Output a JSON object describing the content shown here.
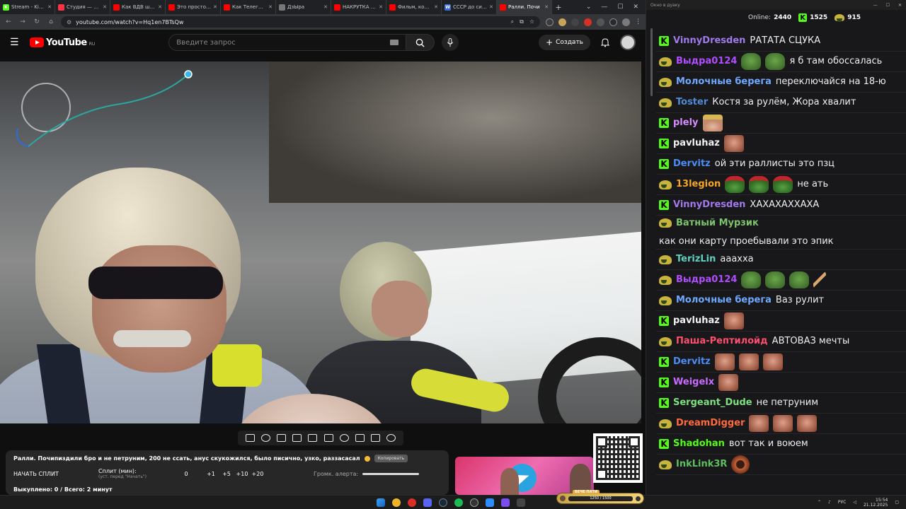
{
  "browser": {
    "tabs": [
      {
        "title": "Stream - Kick D",
        "fav": "K",
        "color": "#53fc18",
        "active": false
      },
      {
        "title": "Студия — VK В",
        "fav": "",
        "color": "#ff3347",
        "active": false
      },
      {
        "title": "Как ВДВ штурм",
        "fav": "",
        "color": "#ff0000",
        "active": false
      },
      {
        "title": "Это просто пра",
        "fav": "",
        "color": "#ff0000",
        "active": false
      },
      {
        "title": "Как Телеграм м",
        "fav": "",
        "color": "#ff0000",
        "active": false
      },
      {
        "title": "ДзЫра",
        "fav": "",
        "color": "#777777",
        "active": false
      },
      {
        "title": "НАКРУТКА УБИ",
        "fav": "",
        "color": "#ff0000",
        "active": false
      },
      {
        "title": "Фильм, которы",
        "fav": "",
        "color": "#ff0000",
        "active": false
      },
      {
        "title": "СССР до сих п",
        "fav": "W",
        "color": "#3a6bd8",
        "active": false
      },
      {
        "title": "Ралли. Почи",
        "fav": "",
        "color": "#ff0000",
        "active": true
      }
    ],
    "url": "youtube.com/watch?v=Hq1en7BTsQw"
  },
  "youtube": {
    "logo_text": "YouTube",
    "region": "RU",
    "search_placeholder": "Введите запрос",
    "create_label": "Создать"
  },
  "description": {
    "title": "Ралли. Почипиздили бро и не петруним, 200 не ссать, анус скукожился, было писично, узко, раззасасал",
    "copy_label": "Копировать",
    "split_button": "НАЧАТЬ СПЛИТ",
    "split_label": "Сплит (мин):",
    "split_sub": "(уст. перед \"Начать\")",
    "split_value": "0",
    "increments": [
      "+1",
      "+5",
      "+10",
      "+20"
    ],
    "volume_label": "Громк. алерта:",
    "volume_level": 1.0,
    "spent_text": "Выкуплено: 0 / Всего: 2 минут"
  },
  "party_widget": {
    "label": "ВЕЧЕ ПАТИ",
    "progress_text": "1250 / 1500"
  },
  "chat": {
    "window_title": "Окно в дуаку",
    "online_label": "Online:",
    "online_count": "2440",
    "kick_count": "1525",
    "coin_count": "915",
    "messages": [
      {
        "badge": "k",
        "nick": "VinnyDresden",
        "color": "#9f7aea",
        "text": "РАТАТА СЦУКА",
        "emotes": []
      },
      {
        "badge": "frog",
        "nick": "Выдра0124",
        "color": "#b04dff",
        "text": "я б там обоссалась",
        "emotes": [
          "frog",
          "frog"
        ]
      },
      {
        "badge": "frog",
        "nick": "Молочные берега",
        "color": "#6fa8ff",
        "text": "переключайся на 18-ю",
        "emotes": []
      },
      {
        "badge": "frog",
        "nick": "Toster",
        "color": "#4f8bd6",
        "text": "Костя за рулём, Жора хвалит",
        "emotes": []
      },
      {
        "badge": "k",
        "nick": "plely",
        "color": "#d78bff",
        "text": "",
        "emotes": [
          "blonde"
        ]
      },
      {
        "badge": "k",
        "nick": "pavluhaz",
        "color": "#f2f2f2",
        "text": "",
        "emotes": [
          "face"
        ]
      },
      {
        "badge": "k",
        "nick": "Dervitz",
        "color": "#4c8cf5",
        "text": "ой эти раллисты это пзц",
        "emotes": []
      },
      {
        "badge": "frog",
        "nick": "13legion",
        "color": "#f5a623",
        "text": "не ать",
        "emotes": [
          "xmas",
          "xmas",
          "xmas"
        ]
      },
      {
        "badge": "k",
        "nick": "VinnyDresden",
        "color": "#9f7aea",
        "text": "ХАХАХАХХАХА",
        "emotes": []
      },
      {
        "badge": "frog",
        "nick": "Ватный Мурзик",
        "color": "#7cc26c",
        "text": "как они карту проебывали это эпик",
        "emotes": []
      },
      {
        "badge": "frog",
        "nick": "TerizLin",
        "color": "#5fd0c0",
        "text": "аааххa",
        "emotes": []
      },
      {
        "badge": "frog",
        "nick": "Выдра0124",
        "color": "#b04dff",
        "text": "",
        "emotes": [
          "frog",
          "frog",
          "frog",
          "cig"
        ]
      },
      {
        "badge": "frog",
        "nick": "Молочные берега",
        "color": "#6fa8ff",
        "text": "Ваз рулит",
        "emotes": []
      },
      {
        "badge": "k",
        "nick": "pavluhaz",
        "color": "#f2f2f2",
        "text": "",
        "emotes": [
          "face"
        ]
      },
      {
        "badge": "frog",
        "nick": "Паша-Рептилойд",
        "color": "#ff4f6e",
        "text": "АВТОВАЗ мечты",
        "emotes": []
      },
      {
        "badge": "k",
        "nick": "Dervitz",
        "color": "#4c8cf5",
        "text": "",
        "emotes": [
          "face",
          "face",
          "face"
        ]
      },
      {
        "badge": "k",
        "nick": "Weigelx",
        "color": "#c86bff",
        "text": "",
        "emotes": [
          "face"
        ]
      },
      {
        "badge": "k",
        "nick": "Sergeant_Dude",
        "color": "#7ee07e",
        "text": "не петруним",
        "emotes": []
      },
      {
        "badge": "frog",
        "nick": "DreamDigger",
        "color": "#ff6a3d",
        "text": "",
        "emotes": [
          "face",
          "face",
          "face"
        ]
      },
      {
        "badge": "k",
        "nick": "Shadohan",
        "color": "#53fc18",
        "text": "вот так и воюем",
        "emotes": []
      },
      {
        "badge": "frog",
        "nick": "InkLink3R",
        "color": "#5fbf5f",
        "text": "",
        "emotes": [
          "donut"
        ]
      }
    ]
  },
  "taskbar": {
    "lang": "РУС",
    "time": "15:54",
    "date": "21.12.2025"
  },
  "colors": {
    "kick_green": "#53fc18",
    "youtube_red": "#ff0000",
    "chat_bg": "#18181b"
  }
}
